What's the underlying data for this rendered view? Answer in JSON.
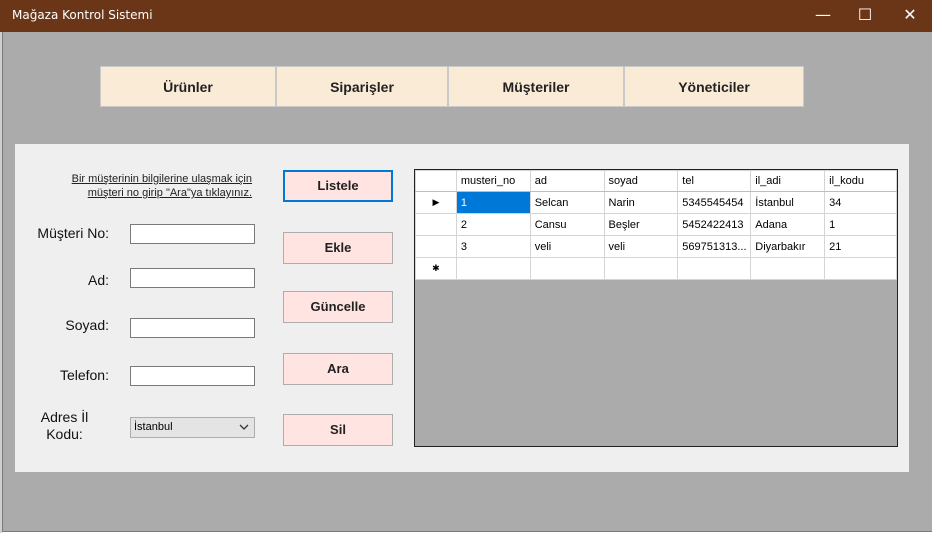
{
  "window": {
    "title": "Mağaza Kontrol Sistemi",
    "minimize": "—",
    "maximize": "☐",
    "close": "✕"
  },
  "nav": {
    "urunler": "Ürünler",
    "siparisler": "Siparişler",
    "musteriler": "Müşteriler",
    "yoneticiler": "Yöneticiler"
  },
  "info": {
    "line1": "Bir müşterinin bilgilerine ulaşmak için",
    "line2": "müşteri no girip \"Ara\"ya tıklayınız."
  },
  "labels": {
    "musteri_no": "Müşteri No:",
    "ad": "Ad:",
    "soyad": "Soyad:",
    "telefon": "Telefon:",
    "adres_line1": "Adres İl",
    "adres_line2": "Kodu:"
  },
  "fields": {
    "musteri_no": "",
    "ad": "",
    "soyad": "",
    "telefon": ""
  },
  "combo": {
    "selected": "İstanbul"
  },
  "buttons": {
    "listele": "Listele",
    "ekle": "Ekle",
    "guncelle": "Güncelle",
    "ara": "Ara",
    "sil": "Sil"
  },
  "grid": {
    "columns": [
      "musteri_no",
      "ad",
      "soyad",
      "tel",
      "il_adi",
      "il_kodu"
    ],
    "rows": [
      [
        "1",
        "Selcan",
        "Narin",
        "5345545454",
        "İstanbul",
        "34"
      ],
      [
        "2",
        "Cansu",
        "Beşler",
        "5452422413",
        "Adana",
        "1"
      ],
      [
        "3",
        "veli",
        "veli",
        "569751313...",
        "Diyarbakır",
        "21"
      ]
    ],
    "current_row_marker": "▶",
    "new_row_marker": "✱"
  }
}
